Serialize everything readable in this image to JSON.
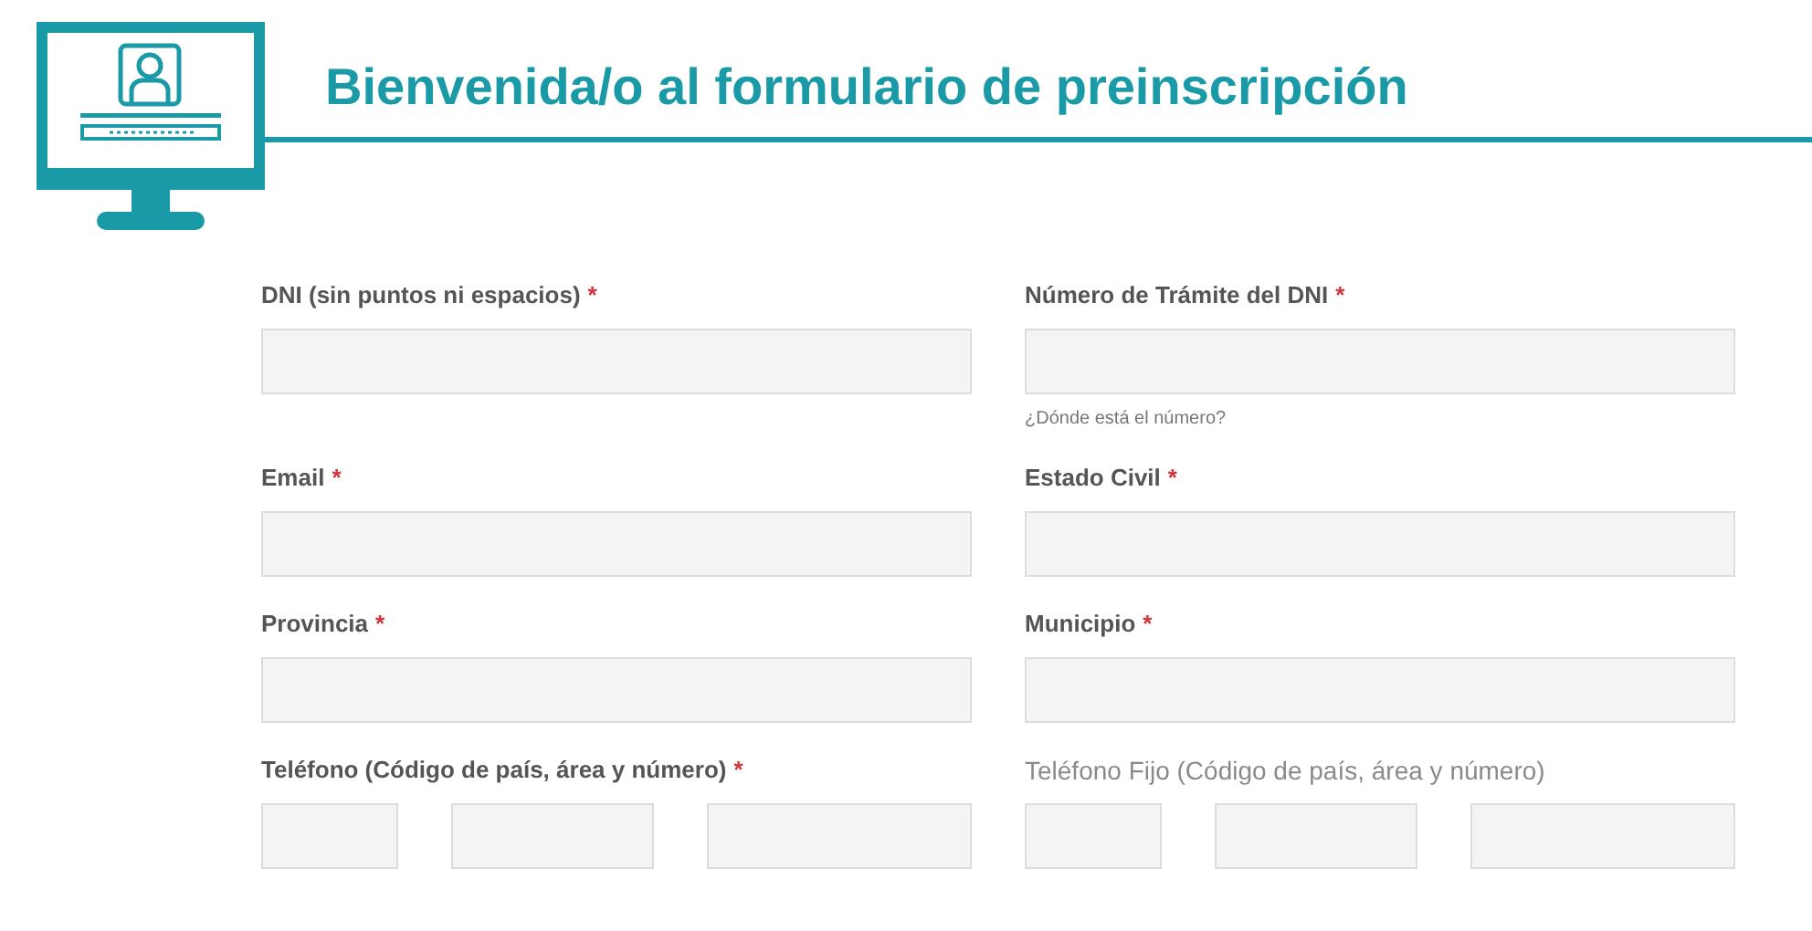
{
  "header": {
    "title": "Bienvenida/o al formulario de preinscripción"
  },
  "form": {
    "required_mark": "*",
    "fields": [
      {
        "label": "DNI (sin puntos ni espacios)",
        "required": true,
        "kind": "text"
      },
      {
        "label": "Número de Trámite del DNI",
        "required": true,
        "kind": "text",
        "help": "¿Dónde está el número?"
      },
      {
        "label": "Email",
        "required": true,
        "kind": "text"
      },
      {
        "label": "Estado Civil",
        "required": true,
        "kind": "text"
      },
      {
        "label": "Provincia",
        "required": true,
        "kind": "text"
      },
      {
        "label": "Municipio",
        "required": true,
        "kind": "text"
      },
      {
        "label": "Teléfono (Código de país, área y número)",
        "required": true,
        "kind": "phone"
      },
      {
        "label": "Teléfono Fijo (Código de país, área y número)",
        "required": false,
        "kind": "phone"
      }
    ]
  }
}
